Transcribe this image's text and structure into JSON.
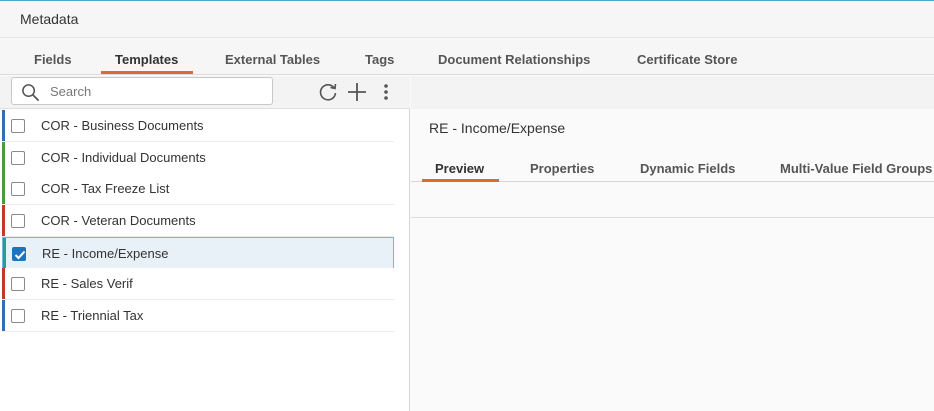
{
  "window": {
    "title": "Metadata"
  },
  "top_tabs": [
    {
      "label": "Fields",
      "active": false
    },
    {
      "label": "Templates",
      "active": true
    },
    {
      "label": "External Tables",
      "active": false
    },
    {
      "label": "Tags",
      "active": false
    },
    {
      "label": "Document Relationships",
      "active": false
    },
    {
      "label": "Certificate Store",
      "active": false
    }
  ],
  "search": {
    "placeholder": "Search",
    "value": ""
  },
  "toolbar": {
    "refresh_icon": "refresh-icon",
    "add_icon": "plus-icon",
    "more_icon": "more-vertical-icon"
  },
  "templates": [
    {
      "label": "COR - Business Documents",
      "stripe_color": "#2f6fb5",
      "checked": false
    },
    {
      "label": "COR - Individual Documents",
      "stripe_color": "#4a9a3e",
      "checked": false
    },
    {
      "label": "COR - Tax Freeze List",
      "stripe_color": "#4a9a3e",
      "checked": false
    },
    {
      "label": "COR - Veteran Documents",
      "stripe_color": "#c0392b",
      "checked": false
    },
    {
      "label": "RE - Income/Expense",
      "stripe_color": "#2e9a8a",
      "checked": true
    },
    {
      "label": "RE - Sales Verif",
      "stripe_color": "#c0392b",
      "checked": false
    },
    {
      "label": "RE - Triennial Tax",
      "stripe_color": "#2f6fb5",
      "checked": false
    }
  ],
  "detail": {
    "title": "RE - Income/Expense",
    "tabs": [
      {
        "label": "Preview",
        "active": true
      },
      {
        "label": "Properties",
        "active": false
      },
      {
        "label": "Dynamic Fields",
        "active": false
      },
      {
        "label": "Multi-Value Field Groups",
        "active": false
      }
    ]
  },
  "colors": {
    "accent": "#e06a2e",
    "selection_border": "#76b7d6",
    "checkbox_checked": "#1e73be"
  }
}
